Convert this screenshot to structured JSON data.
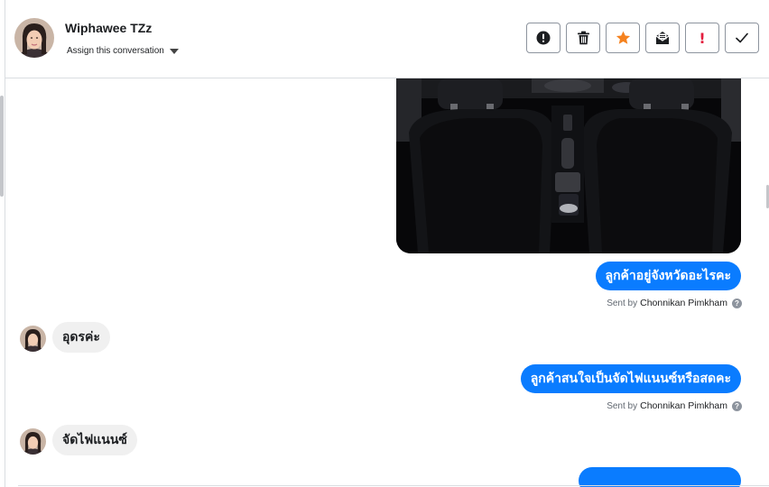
{
  "header": {
    "contact_name": "Wiphawee TZz",
    "assign_label": "Assign this conversation"
  },
  "toolbar": {
    "buttons": [
      {
        "name": "spam",
        "icon": "alert-circle-icon"
      },
      {
        "name": "delete",
        "icon": "trash-icon"
      },
      {
        "name": "star",
        "icon": "star-icon",
        "color": "#f5821f"
      },
      {
        "name": "mark-unread",
        "icon": "envelope-icon"
      },
      {
        "name": "follow-up",
        "icon": "exclamation-icon",
        "color": "#e41e3f"
      },
      {
        "name": "done",
        "icon": "check-icon"
      }
    ]
  },
  "messages": [
    {
      "direction": "outgoing",
      "type": "image",
      "icon": "car-interior-photo"
    },
    {
      "direction": "outgoing",
      "text": "ลูกค้าอยู่จังหวัดอะไรคะ",
      "sent_by_prefix": "Sent by",
      "agent": "Chonnikan Pimkham"
    },
    {
      "direction": "incoming",
      "text": "อุดรค่ะ"
    },
    {
      "direction": "outgoing",
      "text": "ลูกค้าสนใจเป็นจัดไฟแนนซ์หรือสดคะ",
      "sent_by_prefix": "Sent by",
      "agent": "Chonnikan Pimkham"
    },
    {
      "direction": "incoming",
      "text": "จัดไฟแนนซ์"
    }
  ],
  "colors": {
    "outgoing_bubble": "#0a7cff",
    "incoming_bubble": "#f0f0f0",
    "star_active": "#f5821f",
    "follow_up": "#e41e3f"
  }
}
